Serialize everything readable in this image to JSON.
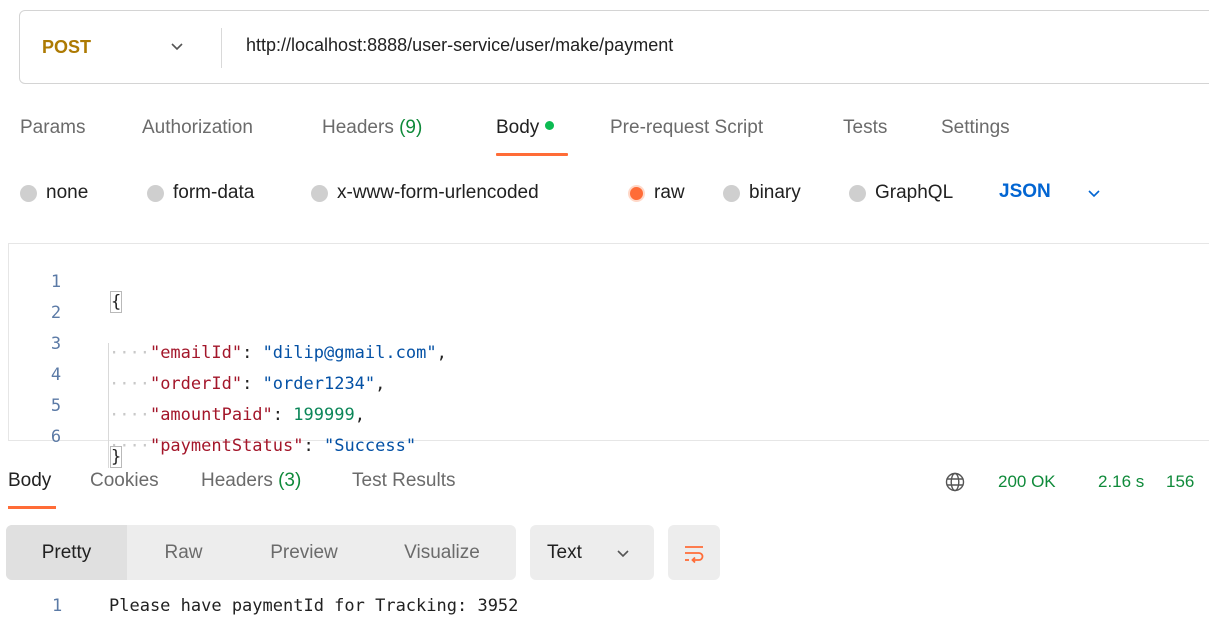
{
  "request": {
    "method": "POST",
    "url": "http://localhost:8888/user-service/user/make/payment"
  },
  "request_tabs": {
    "params": "Params",
    "authorization": "Authorization",
    "headers_label": "Headers",
    "headers_count": "(9)",
    "body": "Body",
    "prerequest": "Pre-request Script",
    "tests": "Tests",
    "settings": "Settings"
  },
  "body_types": {
    "none": "none",
    "form_data": "form-data",
    "urlencoded": "x-www-form-urlencoded",
    "raw": "raw",
    "binary": "binary",
    "graphql": "GraphQL",
    "selected": "raw",
    "format": "JSON"
  },
  "editor": {
    "lines": [
      {
        "n": "1",
        "open": "{"
      },
      {
        "n": "2",
        "key": "\"emailId\"",
        "sep": ": ",
        "value": "\"dilip@gmail.com\"",
        "end": ","
      },
      {
        "n": "3",
        "key": "\"orderId\"",
        "sep": ": ",
        "value": "\"order1234\"",
        "end": ","
      },
      {
        "n": "4",
        "key": "\"amountPaid\"",
        "sep": ": ",
        "value": "199999",
        "end": ","
      },
      {
        "n": "5",
        "key": "\"paymentStatus\"",
        "sep": ": ",
        "value": "\"Success\"",
        "end": ""
      },
      {
        "n": "6",
        "close": "}"
      }
    ]
  },
  "response_tabs": {
    "body": "Body",
    "cookies": "Cookies",
    "headers_label": "Headers",
    "headers_count": "(3)",
    "test_results": "Test Results"
  },
  "response_meta": {
    "status": "200 OK",
    "time": "2.16 s",
    "size": "156"
  },
  "response_view": {
    "pretty": "Pretty",
    "raw": "Raw",
    "preview": "Preview",
    "visualize": "Visualize",
    "format": "Text"
  },
  "response_body": {
    "line_number": "1",
    "text": "Please have paymentId for Tracking: 3952"
  },
  "colors": {
    "accent": "#ff6c37",
    "method": "#ad7a03",
    "status_ok": "#0f8a3a",
    "json_key": "#a3162a",
    "json_string": "#0451a5",
    "json_number": "#0b8658"
  }
}
